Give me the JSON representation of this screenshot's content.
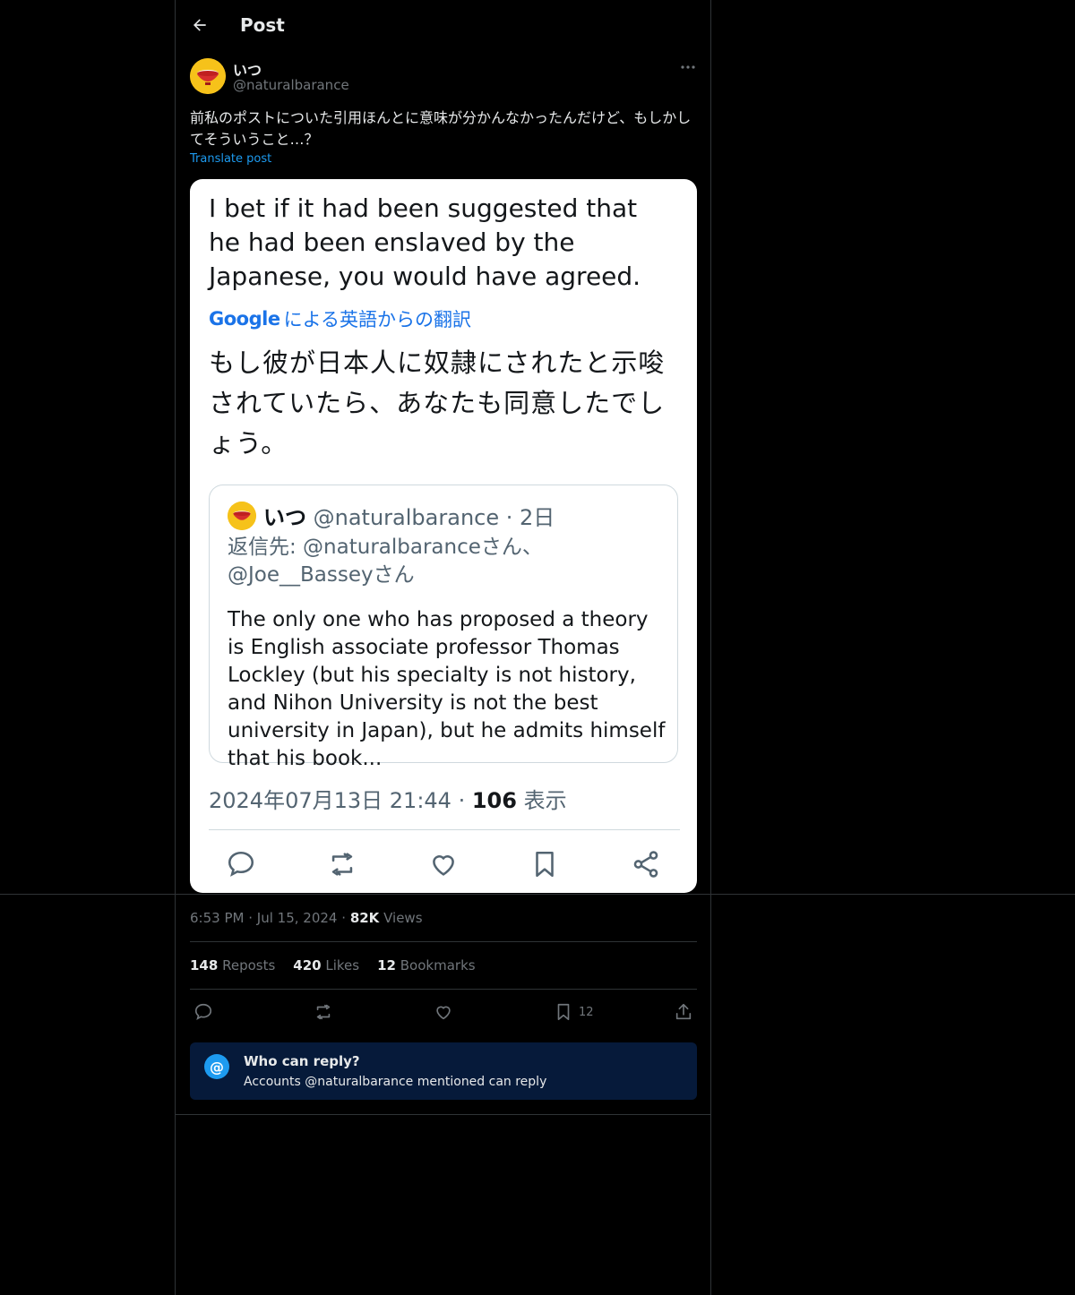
{
  "header": {
    "title": "Post",
    "back_icon": "arrow-left-icon"
  },
  "author": {
    "name": "いつ",
    "handle": "@naturalbarance"
  },
  "post": {
    "text": "前私のポストについた引用ほんとに意味が分かんなかったんだけど、もしかしてそういうこと…？",
    "translate_label": "Translate post"
  },
  "media": {
    "english_text": "I bet if it had been suggested that he had been enslaved by the Japanese, you would have agreed.",
    "google_label": "Google",
    "translation_label": "による英語からの翻訳",
    "japanese_text": "もし彼が日本人に奴隷にされたと示唆されていたら、あなたも同意したでしょう。",
    "quote": {
      "name": "いつ",
      "handle_date": "@naturalbarance · 2日",
      "reply_to": "返信先: @naturalbaranceさん、@Joe__Basseyさん",
      "body": "The only one who has proposed a theory is English associate professor Thomas Lockley (but his specialty is not history, and Nihon University is not the best university in Japan), but he admits himself that his book..."
    },
    "meta_time": "2024年07月13日 21:44 · ",
    "meta_views": "106",
    "meta_views_label": " 表示"
  },
  "timestamp": {
    "time": "6:53 PM",
    "dot": "·",
    "date": "Jul 15, 2024",
    "dot2": "·",
    "views": "82K",
    "views_label": "Views"
  },
  "stats": {
    "reposts": "148",
    "reposts_label": "Reposts",
    "likes": "420",
    "likes_label": "Likes",
    "bookmarks": "12",
    "bookmarks_label": "Bookmarks"
  },
  "actions": {
    "bookmark_count": "12"
  },
  "reply_restriction": {
    "title": "Who can reply?",
    "subtitle": "Accounts @naturalbarance mentioned can reply"
  },
  "colors": {
    "accent": "#1d9bf0",
    "background": "#000000",
    "muted": "#71767b",
    "reply_box": "#061a3a"
  }
}
